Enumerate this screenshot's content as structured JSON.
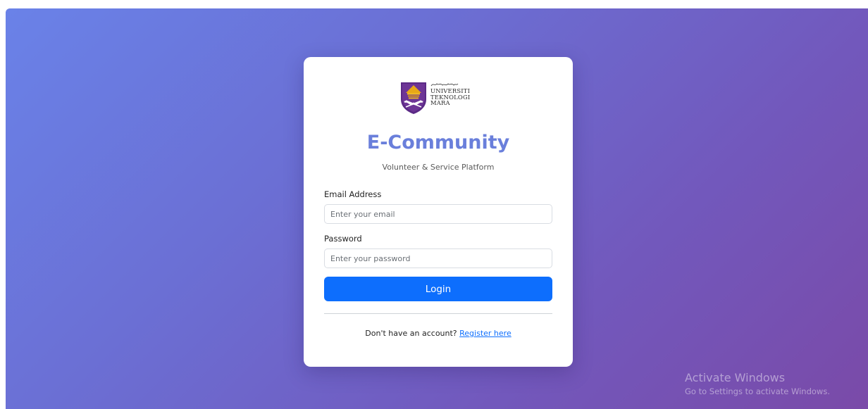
{
  "logo": {
    "lines": [
      "UNIVERSITI",
      "TEKNOLOGI",
      "MARA"
    ]
  },
  "app": {
    "title": "E-Community",
    "subtitle": "Volunteer & Service Platform"
  },
  "form": {
    "email_label": "Email Address",
    "email_placeholder": "Enter your email",
    "email_value": "",
    "password_label": "Password",
    "password_placeholder": "Enter your password",
    "password_value": "",
    "login_label": "Login",
    "register_prompt": "Don't have an account?",
    "register_link": "Register here"
  },
  "watermark": {
    "title": "Activate Windows",
    "subtitle": "Go to Settings to activate Windows."
  },
  "colors": {
    "accent": "#0d6efd",
    "title": "#6a7fdb",
    "gradient_start": "#6a82e8",
    "gradient_end": "#7a4aa8"
  }
}
